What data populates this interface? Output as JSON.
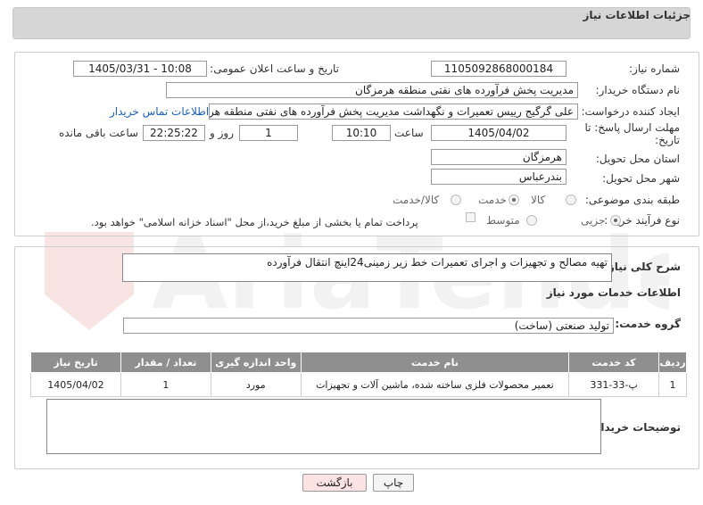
{
  "header": {
    "title": "جزئیات اطلاعات نیاز"
  },
  "form": {
    "need_number_label": "شماره نیاز:",
    "need_number": "1105092868000184",
    "announce_label": "تاریخ و ساعت اعلان عمومی:",
    "announce_value": "1405/03/31 - 10:08",
    "buyer_org_label": "نام دستگاه خریدار:",
    "buyer_org": "مدیریت پخش فرآورده های نفتی منطقه هرمزگان",
    "creator_label": "ایجاد کننده درخواست:",
    "creator": "علی گرگیج رییس تعمیرات و نگهداشت مدیریت پخش فرآورده های نفتی منطقه هرمزگان",
    "contact_link": "اطلاعات تماس خریدار",
    "deadline_label_1": "مهلت ارسال پاسخ: تا",
    "deadline_label_2": "تاریخ:",
    "deadline_date": "1405/04/02",
    "time_label": "ساعت",
    "deadline_time": "10:10",
    "days_value": "1",
    "days_label": "روز و",
    "remaining_time": "22:25:22",
    "remaining_label": "ساعت باقی مانده",
    "province_label": "استان محل تحویل:",
    "province": "هرمزگان",
    "city_label": "شهر محل تحویل:",
    "city": "بندرعباس",
    "category_label": "طبقه بندی موضوعی:",
    "category_options": [
      "کالا",
      "خدمت",
      "کالا/خدمت"
    ],
    "process_label": "نوع فرآیند خرید :",
    "process_options": [
      "جزیی",
      "متوسط"
    ],
    "payment_note": "پرداخت تمام یا بخشی از مبلغ خرید،از محل \"اسناد خزانه اسلامی\" خواهد بود."
  },
  "details": {
    "summary_label": "شرح کلی نیاز:",
    "summary": "تهیه مصالح و تجهیزات و اجرای تعمیرات خط زیر زمینی24اینچ انتقال فرآورده",
    "services_title": "اطلاعات خدمات مورد نیاز",
    "service_group_label": "گروه خدمت:",
    "service_group": "تولید صنعتی (ساخت)",
    "table": {
      "headers": [
        "ردیف",
        "کد خدمت",
        "نام خدمت",
        "واحد اندازه گیری",
        "تعداد / مقدار",
        "تاریخ نیاز"
      ],
      "rows": [
        [
          "1",
          "پ-33-331",
          "تعمیر محصولات فلزی ساخته شده، ماشین آلات و تجهیزات",
          "مورد",
          "1",
          "1405/04/02"
        ]
      ]
    },
    "buyer_notes_label": "توضیحات خریدار:"
  },
  "buttons": {
    "print": "چاپ",
    "back": "بازگشت"
  },
  "colors": {
    "back_button_bg": "#fbe3e3",
    "link": "#1a5fb4",
    "table_header": "#8f8f8f"
  }
}
